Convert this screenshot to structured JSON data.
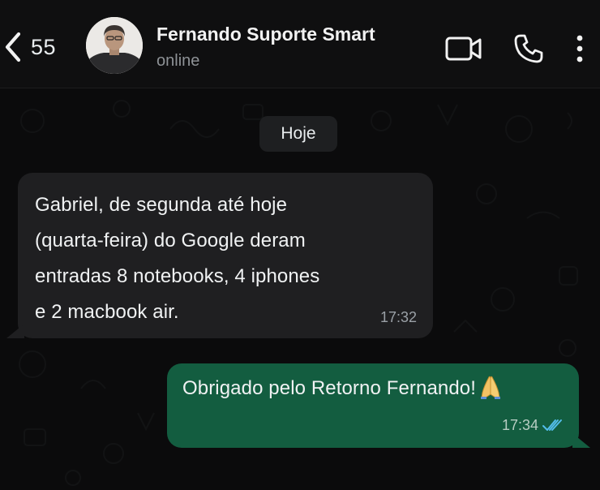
{
  "header": {
    "back_count": "55",
    "contact_name": "Fernando Suporte Smart",
    "status": "online",
    "icons": [
      "chevron-left-icon",
      "video-call-icon",
      "phone-icon",
      "more-vertical-icon"
    ]
  },
  "chat": {
    "date_label": "Hoje",
    "messages": [
      {
        "direction": "incoming",
        "text": "Gabriel, de segunda até hoje\n(quarta-feira) do Google deram\nentradas 8 notebooks, 4 iphones\ne 2 macbook air.",
        "time": "17:32"
      },
      {
        "direction": "outgoing",
        "text": "Obrigado pelo Retorno Fernando!",
        "emoji": "folded-hands",
        "time": "17:34",
        "read_status": "read"
      }
    ]
  },
  "colors": {
    "background": "#0b0b0c",
    "incoming_bubble": "#1f1f21",
    "outgoing_bubble": "#135d40",
    "read_ticks": "#53bdeb"
  }
}
